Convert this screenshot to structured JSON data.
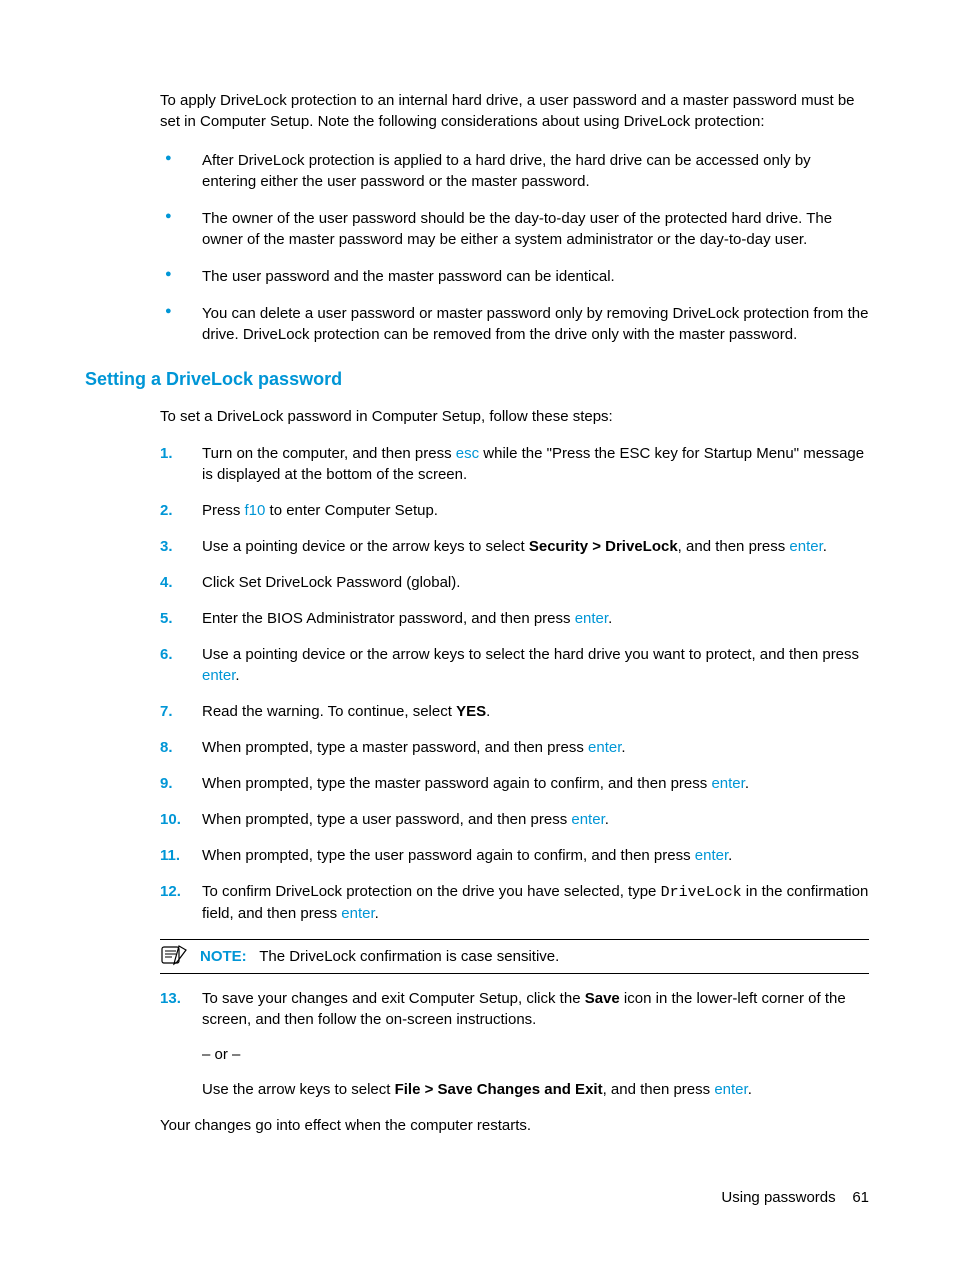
{
  "intro": "To apply DriveLock protection to an internal hard drive, a user password and a master password must be set in Computer Setup. Note the following considerations about using DriveLock protection:",
  "bullets": [
    "After DriveLock protection is applied to a hard drive, the hard drive can be accessed only by entering either the user password or the master password.",
    "The owner of the user password should be the day-to-day user of the protected hard drive. The owner of the master password may be either a system administrator or the day-to-day user.",
    "The user password and the master password can be identical.",
    "You can delete a user password or master password only by removing DriveLock protection from the drive. DriveLock protection can be removed from the drive only with the master password."
  ],
  "section_heading": "Setting a DriveLock password",
  "lead": "To set a DriveLock password in Computer Setup, follow these steps:",
  "steps": {
    "s1_a": "Turn on the computer, and then press ",
    "s1_key": "esc",
    "s1_b": " while the \"Press the ESC key for Startup Menu\" message is displayed at the bottom of the screen.",
    "s2_a": "Press ",
    "s2_key": "f10",
    "s2_b": " to enter Computer Setup.",
    "s3_a": "Use a pointing device or the arrow keys to select ",
    "s3_bold": "Security > DriveLock",
    "s3_b": ", and then press ",
    "s3_key": "enter",
    "s3_c": ".",
    "s4": "Click Set DriveLock Password (global).",
    "s5_a": "Enter the BIOS Administrator password, and then press ",
    "s5_key": "enter",
    "s5_b": ".",
    "s6_a": "Use a pointing device or the arrow keys to select the hard drive you want to protect, and then press ",
    "s6_key": "enter",
    "s6_b": ".",
    "s7_a": "Read the warning. To continue, select ",
    "s7_bold": "YES",
    "s7_b": ".",
    "s8_a": "When prompted, type a master password, and then press ",
    "s8_key": "enter",
    "s8_b": ".",
    "s9_a": "When prompted, type the master password again to confirm, and then press ",
    "s9_key": "enter",
    "s9_b": ".",
    "s10_a": "When prompted, type a user password, and then press ",
    "s10_key": "enter",
    "s10_b": ".",
    "s11_a": "When prompted, type the user password again to confirm, and then press ",
    "s11_key": "enter",
    "s11_b": ".",
    "s12_a": "To confirm DriveLock protection on the drive you have selected, type ",
    "s12_mono": "DriveLock",
    "s12_b": " in the confirmation field, and then press ",
    "s12_key": "enter",
    "s12_c": ".",
    "s13_a": "To save your changes and exit Computer Setup, click the ",
    "s13_bold1": "Save",
    "s13_b": " icon in the lower-left corner of the screen, and then follow the on-screen instructions.",
    "s13_or": "– or –",
    "s13_c": "Use the arrow keys to select ",
    "s13_bold2": "File > Save Changes and Exit",
    "s13_d": ", and then press ",
    "s13_key": "enter",
    "s13_e": "."
  },
  "note_label": "NOTE:",
  "note_text": "The DriveLock confirmation is case sensitive.",
  "closing": "Your changes go into effect when the computer restarts.",
  "footer_text": "Using passwords",
  "footer_page": "61"
}
